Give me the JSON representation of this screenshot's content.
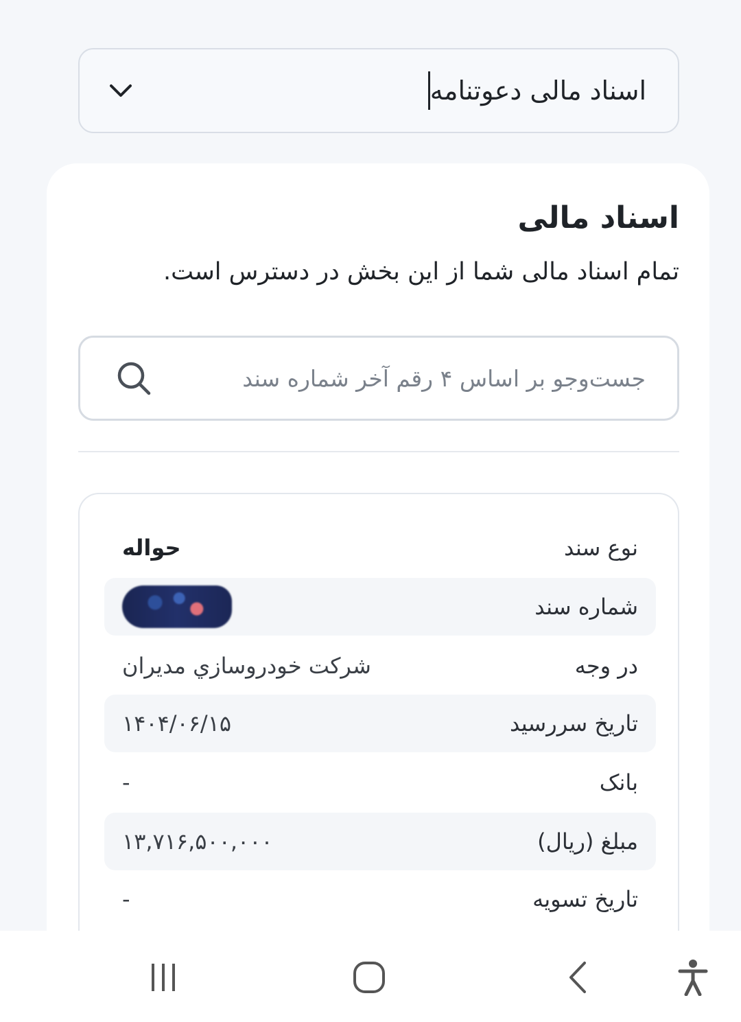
{
  "dropdown": {
    "selected": "اسناد مالی دعوتنامه",
    "icon": "chevron-down-icon"
  },
  "section": {
    "title": "اسناد مالی",
    "subtitle": "تمام اسناد مالی شما از این بخش در دسترس است."
  },
  "search": {
    "placeholder": "جست‌وجو بر اساس ۴ رقم آخر شماره سند",
    "value": "",
    "icon": "search-icon"
  },
  "document": {
    "rows": [
      {
        "label": "نوع سند",
        "value": "حواله"
      },
      {
        "label": "شماره سند",
        "value": ""
      },
      {
        "label": "در وجه",
        "value": "شرکت خودروسازي مديران"
      },
      {
        "label": "تاریخ سررسید",
        "value": "۱۴۰۴/۰۶/۱۵"
      },
      {
        "label": "بانک",
        "value": "-"
      },
      {
        "label": "مبلغ (ریال)",
        "value": "۱۳,۷۱۶,۵۰۰,۰۰۰"
      },
      {
        "label": "تاریخ تسویه",
        "value": "-"
      }
    ]
  },
  "navbar": {
    "icons": [
      "recent-apps-icon",
      "home-icon",
      "back-icon",
      "accessibility-icon"
    ]
  },
  "colors": {
    "background": "#f5f7fa",
    "card": "#ffffff",
    "border": "#d9dee6",
    "text": "#1f2328"
  }
}
